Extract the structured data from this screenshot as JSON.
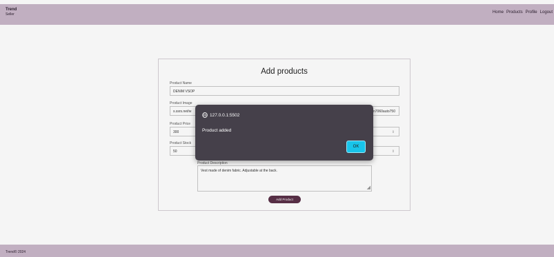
{
  "header": {
    "brand": "Trend",
    "brand_sub": "Seller",
    "nav": [
      "Home",
      "Products",
      "Profile",
      "Logout"
    ]
  },
  "form": {
    "title": "Add products",
    "product_name": {
      "label": "Product Name",
      "value": "DENIM VSOP"
    },
    "product_image": {
      "label": "Product Image",
      "value_left": "s.ssrs.net/w",
      "value_right": "n7060auto750"
    },
    "product_price": {
      "label": "Product Price",
      "value": "300"
    },
    "product_stock": {
      "label": "Product Stock",
      "value": "50"
    },
    "product_description": {
      "label": "Product Description",
      "value": "Vest made of denim fabric. Adjustable at the back."
    },
    "submit_label": "Add Product"
  },
  "dialog": {
    "origin": "127.0.0.1:5502",
    "message": "Product added",
    "ok_label": "OK"
  },
  "footer": {
    "text": "Trend© 2024"
  },
  "colors": {
    "header_bg": "#c9b7c9",
    "dialog_bg": "#45404a",
    "ok_button": "#18c4ea",
    "submit_button": "#5a3048"
  }
}
